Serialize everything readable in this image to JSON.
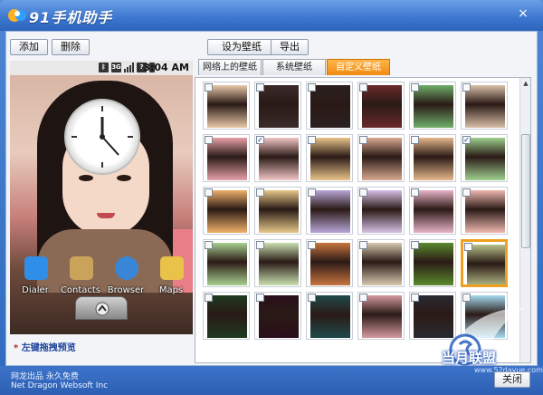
{
  "window": {
    "title": "91手机助手",
    "close_label": "×"
  },
  "toolbar": {
    "add": "添加",
    "delete": "删除",
    "set_wallpaper": "设为壁纸",
    "export": "导出"
  },
  "phone": {
    "status_time": "3:04 AM",
    "status_icons": [
      "bluetooth-icon",
      "3g-icon",
      "signal-icon",
      "alert-icon",
      "battery-icon"
    ],
    "dock": [
      {
        "label": "Dialer",
        "icon": "dialer-icon",
        "color": "#2f8fe8"
      },
      {
        "label": "Contacts",
        "icon": "contacts-icon",
        "color": "#c9a35a"
      },
      {
        "label": "Browser",
        "icon": "browser-icon",
        "color": "#3a86d6"
      },
      {
        "label": "Maps",
        "icon": "maps-icon",
        "color": "#e9c24a"
      }
    ]
  },
  "hint": {
    "prefix": "* ",
    "text": "左键拖拽预览"
  },
  "tabs": [
    {
      "label": "网络上的壁纸",
      "active": false
    },
    {
      "label": "系统壁纸",
      "active": false
    },
    {
      "label": "自定义壁纸",
      "active": true
    }
  ],
  "thumbnails": {
    "checked_mark": "✓",
    "rows": [
      [
        {
          "c": "#e8c9a8",
          "k": false
        },
        {
          "c": "#3a2b2a",
          "k": false
        },
        {
          "c": "#2b2020",
          "k": false
        },
        {
          "c": "#6a2a2a",
          "k": false
        },
        {
          "c": "#6fae6a",
          "k": false
        },
        {
          "c": "#d9bfa8",
          "k": false
        }
      ],
      [
        {
          "c": "#e7a0a8",
          "k": false
        },
        {
          "c": "#f2c6c6",
          "k": true
        },
        {
          "c": "#e9c48a",
          "k": false
        },
        {
          "c": "#d9a890",
          "k": false
        },
        {
          "c": "#e6b78c",
          "k": false
        },
        {
          "c": "#9fd08f",
          "k": true
        }
      ],
      [
        {
          "c": "#f1b06a",
          "k": false
        },
        {
          "c": "#e6c98a",
          "k": false
        },
        {
          "c": "#b8a6d8",
          "k": false
        },
        {
          "c": "#d7c0e6",
          "k": false
        },
        {
          "c": "#e9b3c9",
          "k": false
        },
        {
          "c": "#f0b8b0",
          "k": false
        }
      ],
      [
        {
          "c": "#a8d090",
          "k": false
        },
        {
          "c": "#c9e0b0",
          "k": false
        },
        {
          "c": "#c8753f",
          "k": false
        },
        {
          "c": "#d7c8b0",
          "k": false
        },
        {
          "c": "#5b8a2e",
          "k": false
        },
        {
          "c": "#b9c28a",
          "k": false
        }
      ],
      [
        {
          "c": "#1f3a20",
          "k": false
        },
        {
          "c": "#2a0f1a",
          "k": false
        },
        {
          "c": "#1f4a4a",
          "k": false
        },
        {
          "c": "#d69aa0",
          "k": false
        },
        {
          "c": "#2a2a32",
          "k": false
        },
        {
          "c": "#a6dcf0",
          "k": false
        }
      ]
    ],
    "selected": [
      3,
      5
    ]
  },
  "footer": {
    "line1": "网龙出品 永久免费",
    "line2": "Net Dragon Websoft Inc",
    "close_label": "关闭"
  },
  "watermark": {
    "text": "当月联盟",
    "url": "www.52dayue.com"
  }
}
